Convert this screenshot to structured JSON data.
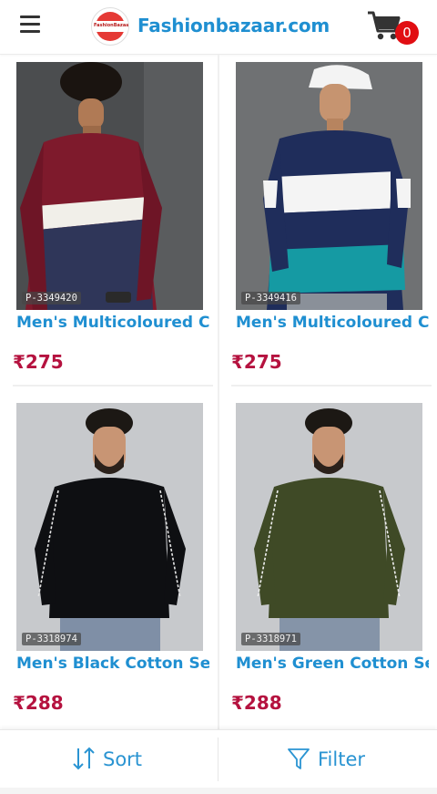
{
  "header": {
    "brand": "Fashionbazaar.com",
    "logo_text": "FashionBazaar",
    "cart_count": "0",
    "icons": {
      "menu": "hamburger-menu-icon",
      "cart": "shopping-cart-icon"
    },
    "colors": {
      "brand": "#1f8fd1",
      "badge": "#e10e12"
    }
  },
  "products": [
    {
      "id": "P-3349420",
      "title": "Men's Multicoloured C...",
      "price": "₹275"
    },
    {
      "id": "P-3349416",
      "title": "Men's Multicoloured C...",
      "price": "₹275"
    },
    {
      "id": "P-3318974",
      "title": "Men's Black Cotton Sel...",
      "price": "₹288"
    },
    {
      "id": "P-3318971",
      "title": "Men's Green Cotton Se...",
      "price": "₹288"
    }
  ],
  "bottom_bar": {
    "sort_label": "Sort",
    "filter_label": "Filter",
    "icons": {
      "sort": "sort-arrows-icon",
      "filter": "funnel-filter-icon"
    }
  },
  "colors": {
    "price": "#b5123f",
    "accent": "#2a94d2"
  }
}
